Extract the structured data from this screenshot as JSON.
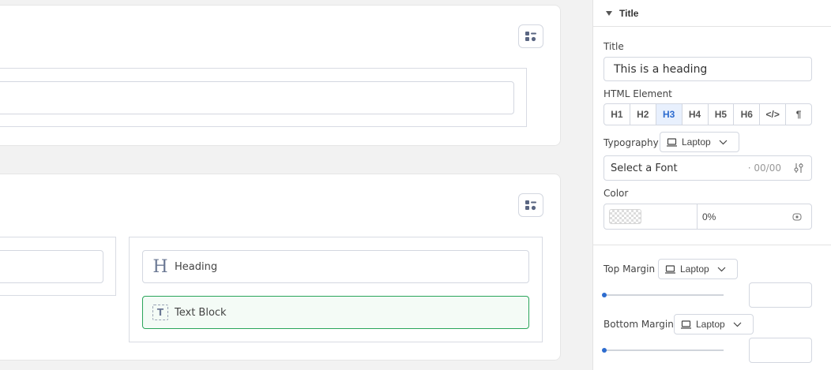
{
  "canvas": {
    "blocks": [
      {
        "icon": "heading-icon",
        "label": "Heading"
      },
      {
        "icon": "text-block-icon",
        "label": "Text Block"
      }
    ],
    "heading_glyph": "H",
    "text_glyph": "T"
  },
  "sidebar": {
    "section_title": "Title",
    "title_label": "Title",
    "title_value": "This is a heading",
    "html_element_label": "HTML Element",
    "html_elements": [
      "H1",
      "H2",
      "H3",
      "H4",
      "H5",
      "H6",
      "</>",
      "¶"
    ],
    "html_element_selected": "H3",
    "typography_label": "Typography",
    "device": "Laptop",
    "font_placeholder": "Select a Font",
    "font_size_placeholder": "· 00/00",
    "color_label": "Color",
    "color_opacity": "0%",
    "top_margin_label": "Top Margin",
    "bottom_margin_label": "Bottom Margin",
    "top_margin_value": 0,
    "bottom_margin_value": 0
  },
  "colors": {
    "accent": "#2d6ccf",
    "active_block_border": "#2aa55a"
  }
}
